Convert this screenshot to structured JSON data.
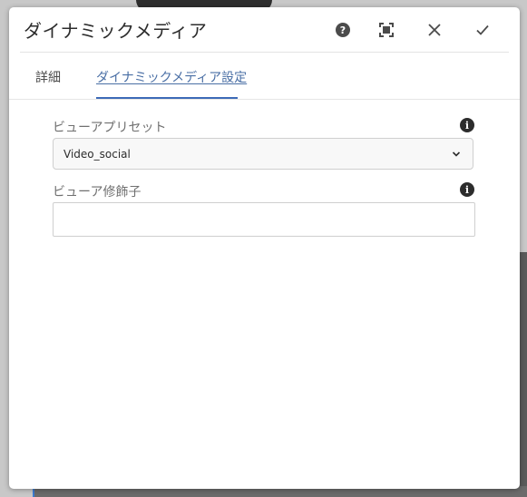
{
  "dialog": {
    "title": "ダイナミックメディア",
    "header_icons": [
      "help-icon",
      "fullscreen-icon",
      "close-icon",
      "done-icon"
    ]
  },
  "tabs": [
    {
      "label": "詳細",
      "active": false
    },
    {
      "label": "ダイナミックメディア設定",
      "active": true
    }
  ],
  "fields": {
    "viewer_preset": {
      "label": "ビューアプリセット",
      "value": "Video_social"
    },
    "viewer_modifier": {
      "label": "ビューア修飾子",
      "value": "",
      "placeholder": ""
    }
  },
  "colors": {
    "accent": "#3d6bb8",
    "active_tab_text": "#4a6fa5",
    "title_text": "#2c2c2c",
    "label_text": "#707070"
  }
}
